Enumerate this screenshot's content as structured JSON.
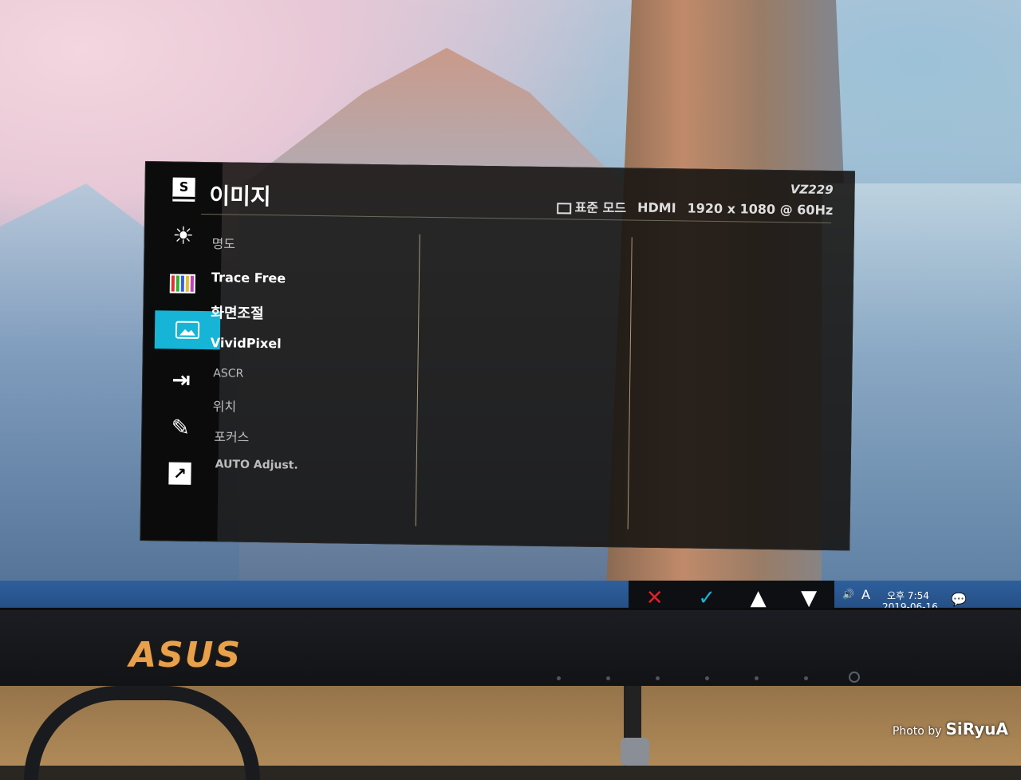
{
  "osd": {
    "title": "이미지",
    "model": "VZ229",
    "mode_label": "표준 모드",
    "input": "HDMI",
    "resolution": "1920 x 1080 @ 60Hz",
    "sidebar": [
      {
        "icon": "splendid-icon",
        "glyph": "S"
      },
      {
        "icon": "bluelight-icon",
        "glyph": "☀"
      },
      {
        "icon": "color-icon",
        "glyph": "▥"
      },
      {
        "icon": "image-icon",
        "glyph": "▣",
        "active": true
      },
      {
        "icon": "input-select-icon",
        "glyph": "⇥"
      },
      {
        "icon": "system-setup-icon",
        "glyph": "🔧"
      },
      {
        "icon": "shortcut-icon",
        "glyph": "↗"
      }
    ],
    "menu": [
      {
        "label": "명도",
        "style": "dim"
      },
      {
        "label": "Trace Free",
        "style": "bold"
      },
      {
        "label": "화면조절",
        "style": "bold"
      },
      {
        "label": "VividPixel",
        "style": "bold"
      },
      {
        "label": "ASCR",
        "style": "dim"
      },
      {
        "label": "위치",
        "style": "dim"
      },
      {
        "label": "포커스",
        "style": "dim"
      },
      {
        "label": "AUTO Adjust.",
        "style": "dim"
      }
    ]
  },
  "controls": {
    "close": "✕",
    "confirm": "✓",
    "up": "▲",
    "down": "▼",
    "colors": {
      "close": "#e0202a",
      "confirm": "#16b4d6",
      "nav": "#ffffff"
    }
  },
  "taskbar": {
    "ime": "A",
    "time": "오후 7:54",
    "date": "2019-06-16"
  },
  "brand": "ASUS",
  "watermark": {
    "prefix": "Photo by",
    "name": "SiRyuA"
  }
}
